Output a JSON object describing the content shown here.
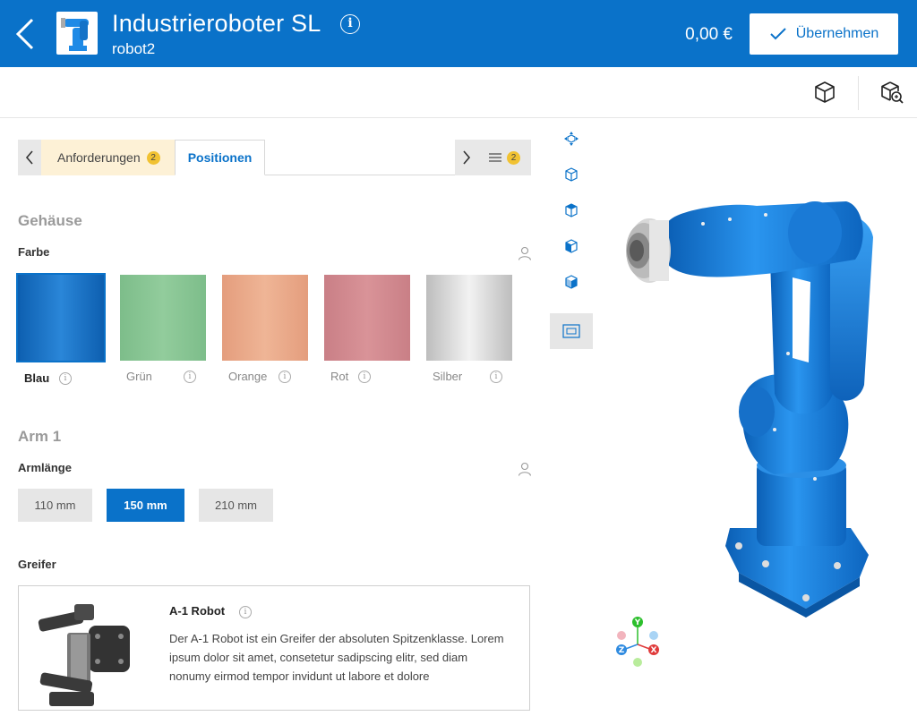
{
  "header": {
    "title": "Industrieroboter SL",
    "subtitle": "robot2",
    "info_icon": "i",
    "price": "0,00 €",
    "apply_label": "Übernehmen",
    "color": "#0a72c9"
  },
  "toolbar": {
    "icons": [
      "cube-icon",
      "cube-zoom-icon"
    ]
  },
  "tabs": {
    "requirements_label": "Anforderungen",
    "requirements_count": "2",
    "positions_label": "Positionen",
    "menu_count": "2"
  },
  "housing": {
    "section_title": "Gehäuse",
    "color_label": "Farbe",
    "swatches": [
      {
        "label": "Blau",
        "color": "#1f7ed4",
        "selected": true
      },
      {
        "label": "Grün",
        "color": "#86c592"
      },
      {
        "label": "Orange",
        "color": "#e8a98a"
      },
      {
        "label": "Rot",
        "color": "#d28b90"
      },
      {
        "label": "Silber",
        "color": "#d8d8d8"
      }
    ]
  },
  "arm": {
    "section_title": "Arm 1",
    "length_label": "Armlänge",
    "options": [
      {
        "label": "110 mm",
        "active": false
      },
      {
        "label": "150 mm",
        "active": true
      },
      {
        "label": "210 mm",
        "active": false
      }
    ]
  },
  "gripper": {
    "label": "Greifer",
    "name": "A-1 Robot",
    "description": "Der A-1 Robot ist ein Greifer der absoluten Spitzenklasse. Lorem ipsum dolor sit amet, consetetur sadipscing elitr, sed diam nonumy eirmod tempor invidunt ut labore et dolore"
  },
  "viewer": {
    "robot_color": "#1e8ae6",
    "axes": {
      "x": "X",
      "y": "Y",
      "z": "Z"
    }
  }
}
